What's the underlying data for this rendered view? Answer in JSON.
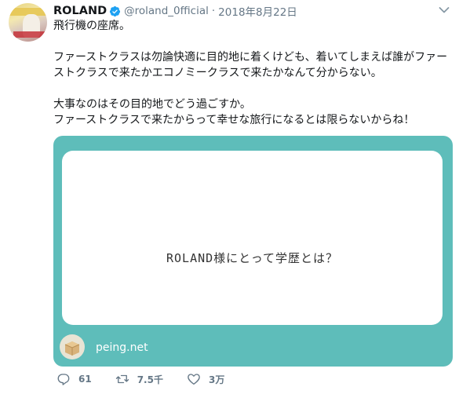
{
  "user": {
    "name": "ROLAND",
    "handle": "@roland_0fficial",
    "separator": "·",
    "date": "2018年8月22日"
  },
  "tweet": {
    "paragraphs": [
      [
        "飛行機の座席。"
      ],
      [
        "ファーストクラスは勿論快適に目的地に着くけども、着いてしまえば誰がファー",
        "ストクラスで来たかエコノミークラスで来たかなんて分からない。"
      ],
      [
        "大事なのはその目的地でどう過ごすか。",
        "ファーストクラスで来たからって幸せな旅行になるとは限らないからね！"
      ]
    ]
  },
  "card": {
    "question": "ROLAND様にとって学歴とは？",
    "domain": "peing.net"
  },
  "actions": {
    "replies": "61",
    "retweets": "7.5千",
    "likes": "3万"
  },
  "icons": {
    "verified": "verified-badge-icon",
    "more": "chevron-down-icon",
    "reply": "reply-icon",
    "retweet": "retweet-icon",
    "like": "heart-icon",
    "card_logo": "box-icon"
  },
  "colors": {
    "card_background": "#5ebdba",
    "verified": "#1da1f2",
    "muted": "#657786"
  }
}
